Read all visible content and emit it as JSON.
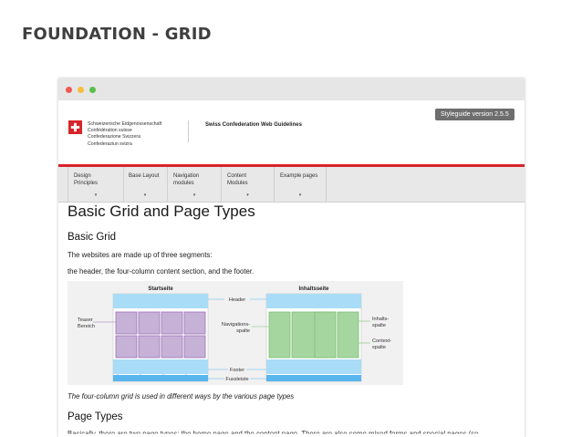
{
  "slide": {
    "title": "FOUNDATION - GRID"
  },
  "colors": {
    "swiss_red": "#d8232a",
    "nav_bg": "#e8e8e8",
    "header_blue": "#a9dcf6",
    "teaser_purple": "#c6b2d6",
    "nav_green": "#a6d6a0"
  },
  "site": {
    "federal_lines": [
      "Schweizerische Eidgenossenschaft",
      "Confédération suisse",
      "Confederazione Svizzera",
      "Confederaziun svizra"
    ],
    "header_title": "Swiss Confederation Web Guidelines",
    "version_badge": "Styleguide version 2.5.5",
    "nav": [
      {
        "line1": "Design",
        "line2": "Principles"
      },
      {
        "line1": "Base Layout",
        "line2": ""
      },
      {
        "line1": "Navigation",
        "line2": "modules"
      },
      {
        "line1": "Content",
        "line2": "Modules"
      },
      {
        "line1": "Example pages",
        "line2": ""
      }
    ],
    "nav_chevron": "▾"
  },
  "content": {
    "h1": "Basic Grid and Page Types",
    "h2_basic": "Basic Grid",
    "p1": "The websites are made up of three segments:",
    "p2": "the header, the four-column content section, and the footer.",
    "caption": "The four-column grid is used in different ways by the various page types",
    "h2_types": "Page Types",
    "cut_text": "Basically, there are two page types: the home page and the content page. There are also some mixed forms and special pages (se"
  },
  "figure": {
    "left_title": "Startseite",
    "right_title": "Inhaltsseite",
    "label_header": "Header",
    "label_teaser1": "Teaser",
    "label_teaser2": "Bereich",
    "label_nav1": "Navigations-",
    "label_nav2": "spalte",
    "label_inhalt1": "Inhalts-",
    "label_inhalt2": "spalte",
    "label_context1": "Context-",
    "label_context2": "spalte",
    "label_footer": "Footer",
    "label_fussleiste": "Fussleiste"
  }
}
